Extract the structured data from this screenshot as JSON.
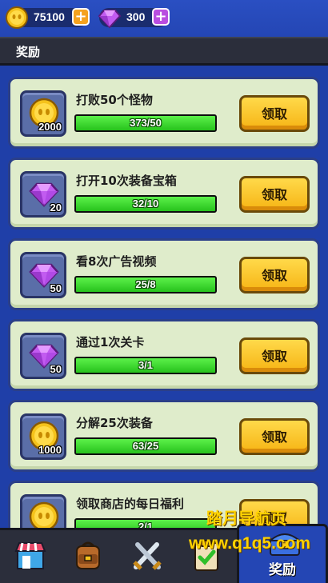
{
  "resources": {
    "gold": {
      "value": "75100",
      "icon": "coin-icon"
    },
    "gems": {
      "value": "300",
      "icon": "gem-icon"
    },
    "plus": "+"
  },
  "header": {
    "title": "奖励"
  },
  "quests": [
    {
      "title": "打败50个怪物",
      "progress_text": "373/50",
      "progress": 1.0,
      "reward_type": "coin",
      "reward_amount": "2000",
      "button": "领取"
    },
    {
      "title": "打开10次装备宝箱",
      "progress_text": "32/10",
      "progress": 1.0,
      "reward_type": "gem",
      "reward_amount": "20",
      "button": "领取"
    },
    {
      "title": "看8次广告视频",
      "progress_text": "25/8",
      "progress": 1.0,
      "reward_type": "gem",
      "reward_amount": "50",
      "button": "领取"
    },
    {
      "title": "通过1次关卡",
      "progress_text": "3/1",
      "progress": 1.0,
      "reward_type": "gem",
      "reward_amount": "50",
      "button": "领取"
    },
    {
      "title": "分解25次装备",
      "progress_text": "63/25",
      "progress": 1.0,
      "reward_type": "coin",
      "reward_amount": "1000",
      "button": "领取"
    },
    {
      "title": "领取商店的每日福利",
      "progress_text": "2/1",
      "progress": 1.0,
      "reward_type": "coin",
      "reward_amount": "",
      "button": "领取"
    }
  ],
  "nav": {
    "items": [
      {
        "name": "shop",
        "icon": "shop-icon"
      },
      {
        "name": "inventory",
        "icon": "backpack-icon"
      },
      {
        "name": "battle",
        "icon": "crossed-swords-icon"
      },
      {
        "name": "tasks",
        "icon": "checklist-icon"
      }
    ],
    "active_label": "奖励"
  },
  "watermark": {
    "line1": "踏月导航页",
    "line2": "www.q1q5.com"
  },
  "colors": {
    "background": "#1f3fa8",
    "card": "#dfeccb",
    "progress": "#3ad82a",
    "button": "#f6b414"
  }
}
